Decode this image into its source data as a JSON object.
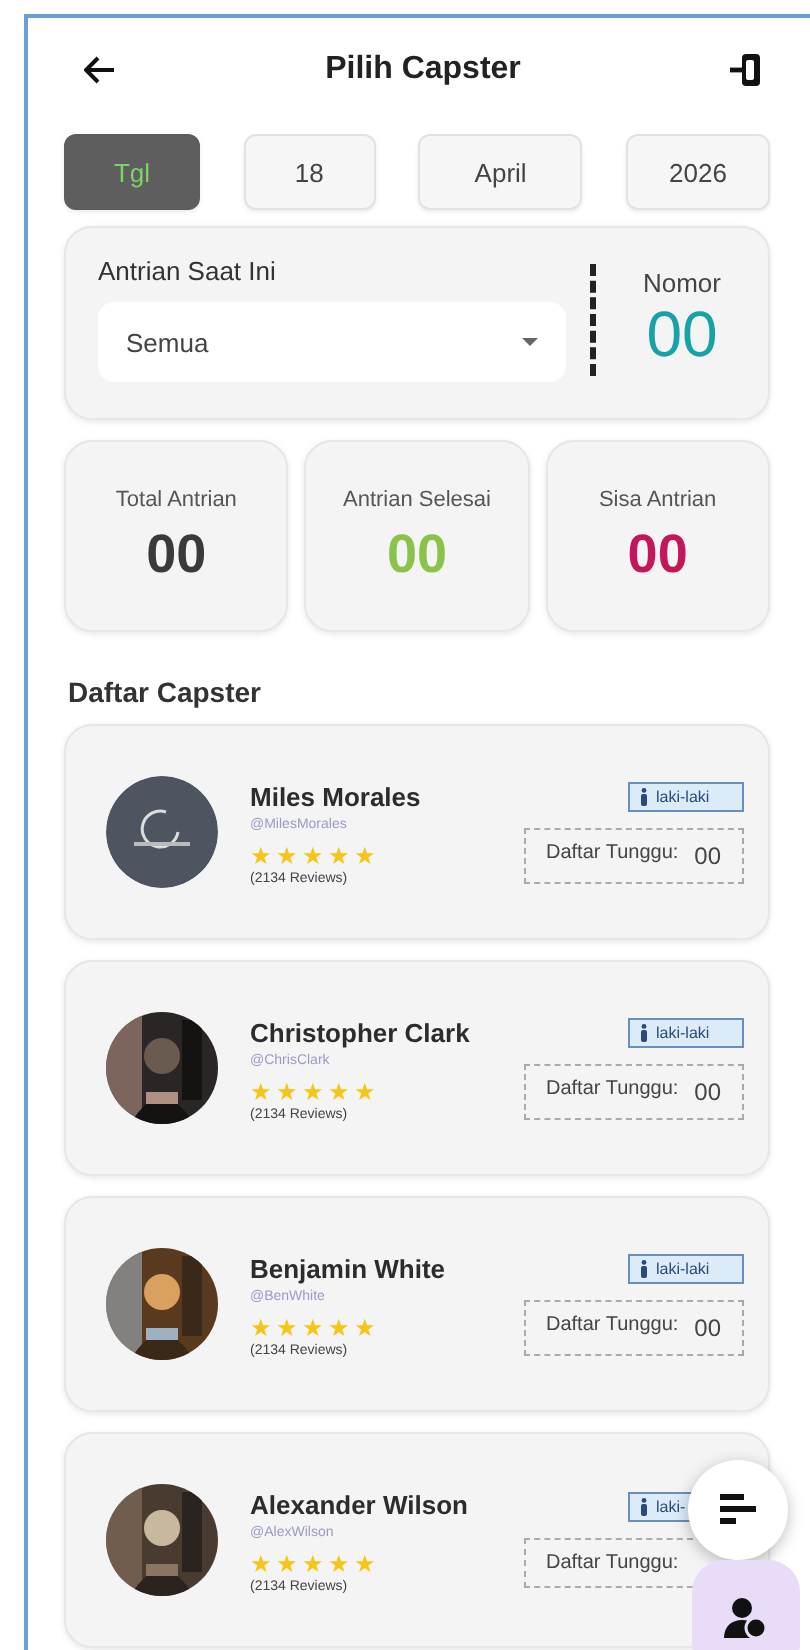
{
  "header": {
    "title": "Pilih Capster"
  },
  "date_tabs": [
    {
      "label": "Tgl",
      "selected": true
    },
    {
      "label": "18",
      "selected": false
    },
    {
      "label": "April",
      "selected": false
    },
    {
      "label": "2026",
      "selected": false
    }
  ],
  "current_queue": {
    "label": "Antrian Saat Ini",
    "dropdown": {
      "value": "Semua"
    },
    "number_label": "Nomor",
    "number": "00"
  },
  "stats": [
    {
      "label": "Total Antrian",
      "value": "00",
      "color": "#3a3a3a"
    },
    {
      "label": "Antrian Selesai",
      "value": "00",
      "color": "#8bc34a"
    },
    {
      "label": "Sisa Antrian",
      "value": "00",
      "color": "#c2185b"
    }
  ],
  "section_title": "Daftar Capster",
  "capsters": [
    {
      "name": "Miles Morales",
      "username": "@MilesMorales",
      "stars": 5,
      "reviews": "(2134 Reviews)",
      "gender": "laki-laki",
      "wait_label": "Daftar Tunggu:",
      "wait_count": "00",
      "avatar": {
        "kind": "logo"
      }
    },
    {
      "name": "Christopher Clark",
      "username": "@ChrisClark",
      "stars": 5,
      "reviews": "(2134 Reviews)",
      "gender": "laki-laki",
      "wait_label": "Daftar Tunggu:",
      "wait_count": "00"
    },
    {
      "name": "Benjamin White",
      "username": "@BenWhite",
      "stars": 5,
      "reviews": "(2134 Reviews)",
      "gender": "laki-laki",
      "wait_label": "Daftar Tunggu:",
      "wait_count": "00"
    },
    {
      "name": "Alexander Wilson",
      "username": "@AlexWilson",
      "stars": 5,
      "reviews": "(2134 Reviews)",
      "gender": "laki-",
      "wait_label": "Daftar Tunggu:"
    }
  ]
}
